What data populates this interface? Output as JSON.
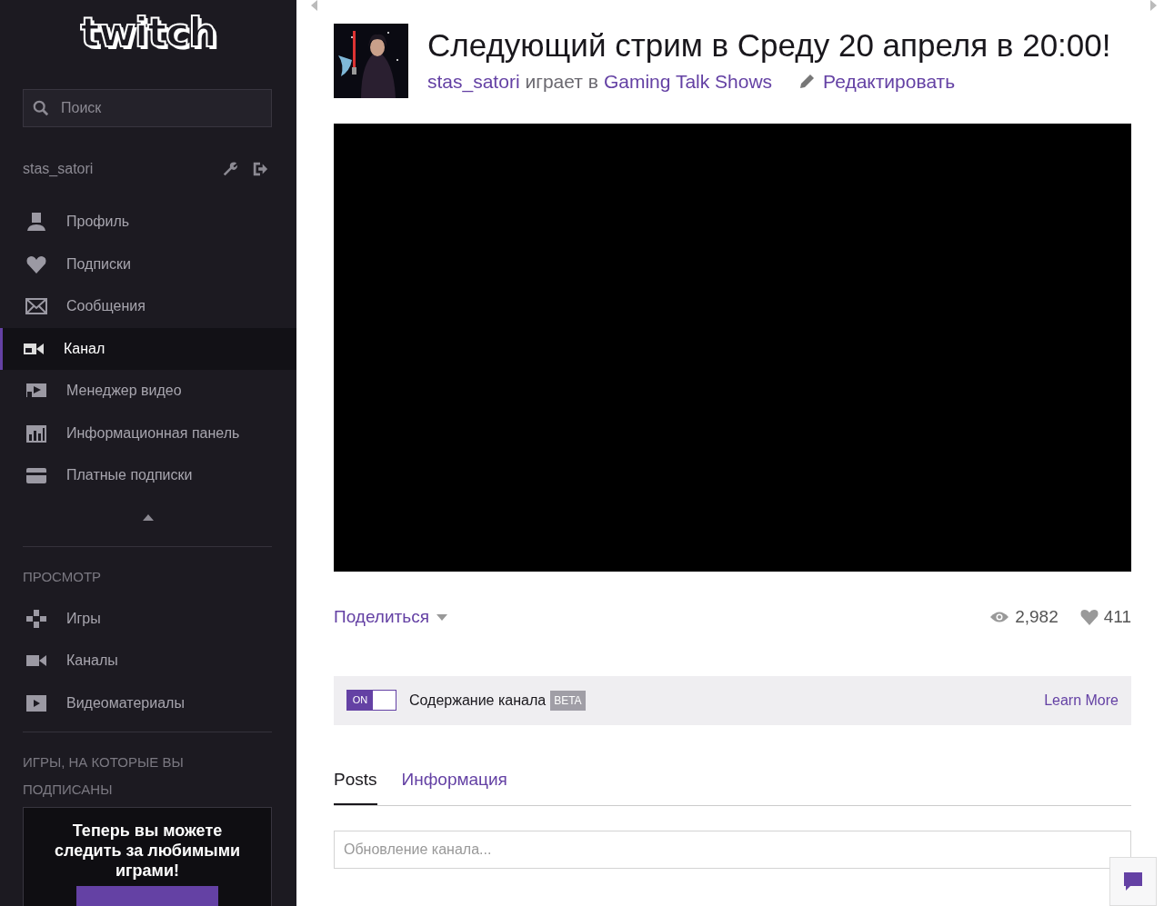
{
  "sidebar": {
    "logo": "twitch",
    "search": {
      "placeholder": "Поиск"
    },
    "username": "stas_satori",
    "account_items": [
      {
        "label": "Профиль",
        "selected": false
      },
      {
        "label": "Подписки",
        "selected": false
      },
      {
        "label": "Сообщения",
        "selected": false
      },
      {
        "label": "Канал",
        "selected": true
      },
      {
        "label": "Менеджер видео",
        "selected": false
      },
      {
        "label": "Информационная панель",
        "selected": false
      },
      {
        "label": "Платные подписки",
        "selected": false
      }
    ],
    "browse_heading": "ПРОСМОТР",
    "browse_items": [
      {
        "label": "Игры",
        "selected": false
      },
      {
        "label": "Каналы",
        "selected": false
      },
      {
        "label": "Видеоматериалы",
        "selected": false
      }
    ],
    "followed_heading": "ИГРЫ, НА КОТОРЫЕ ВЫ ПОДПИСАНЫ",
    "promo": {
      "text": "Теперь вы можете следить за любимыми играми!"
    }
  },
  "channel": {
    "title": "Следующий стрим в Среду 20 апреля в 20:00!",
    "streamer": "stas_satori",
    "playing_text": "играет в",
    "game": "Gaming Talk Shows",
    "edit": "Редактировать"
  },
  "share": "Поделиться",
  "views": "2,982",
  "followers": "411",
  "channel_content": {
    "toggle": {
      "label": "ON",
      "on": true
    },
    "label": "Содержание канала",
    "badge": "BETA",
    "learn_more": "Learn More"
  },
  "tabs": [
    {
      "label": "Posts",
      "selected": true
    },
    {
      "label": "Информация",
      "selected": false
    }
  ],
  "post_field": {
    "placeholder": "Обновление канала..."
  }
}
